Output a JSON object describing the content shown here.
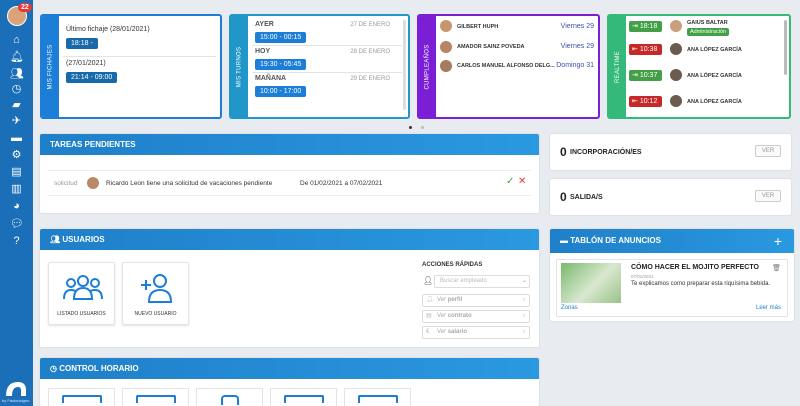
{
  "sidebar": {
    "badge": "22",
    "icons": [
      "home-icon",
      "bell-icon",
      "users-icon",
      "clock-icon",
      "briefcase-icon",
      "plane-icon",
      "folder-icon",
      "gear-icon",
      "clipboard-icon",
      "document-icon",
      "pie-chart-icon",
      "chat-icon",
      "help-icon"
    ],
    "brand": "by Factorialgeo"
  },
  "fichajes": {
    "tab": "MIS FICHAJES",
    "last_label": "Último fichaje (28/01/2021)",
    "last_value": "18:18 -",
    "prev_label": "(27/01/2021)",
    "prev_value": "21:14 - 09:00"
  },
  "turnos": {
    "tab": "MIS TURNOS",
    "rows": [
      {
        "day": "AYER",
        "date": "27 DE ENERO",
        "range": "15:00 - 00:15"
      },
      {
        "day": "HOY",
        "date": "28 DE ENERO",
        "range": "19:30 - 05:45"
      },
      {
        "day": "MAÑANA",
        "date": "29 DE ENERO",
        "range": "10:00 - 17:00"
      }
    ]
  },
  "cumple": {
    "tab": "CUMPLEAÑOS",
    "rows": [
      {
        "name": "GILBERT HUPH",
        "day": "Viernes 29"
      },
      {
        "name": "AMADOR SAINZ POVEDA",
        "day": "Viernes 29"
      },
      {
        "name": "CARLOS MANUEL ALFONSO DELG...",
        "day": "Domingo 31"
      }
    ]
  },
  "realtime": {
    "tab": "REALTIME",
    "rows": [
      {
        "time": "18:18",
        "name": "GAIUS BALTAR",
        "tag": "Administración",
        "color": "#43a047"
      },
      {
        "time": "10:38",
        "name": "ANA LÓPEZ GARCÍA",
        "tag": "",
        "color": "#c62828"
      },
      {
        "time": "10:37",
        "name": "ANA LÓPEZ GARCÍA",
        "tag": "",
        "color": "#43a047"
      },
      {
        "time": "10:12",
        "name": "ANA LÓPEZ GARCÍA",
        "tag": "",
        "color": "#c62828"
      }
    ]
  },
  "tareas": {
    "title": "TAREAS PENDIENTES",
    "type": "solicitud",
    "text": "Ricardo Leon tiene una solicitud de vacaciones pendiente",
    "dates": "De 01/02/2021 a 07/02/2021"
  },
  "incorporacion": {
    "count": "0",
    "label": "INCORPORACIÓN/ES",
    "btn": "VER"
  },
  "salida": {
    "count": "0",
    "label": "SALIDA/S",
    "btn": "VER"
  },
  "usuarios": {
    "title": "USUARIOS",
    "tile1": "LISTADO USUARIOS",
    "tile2": "NUEVO USUARIO",
    "quick_title": "ACCIONES RÁPIDAS",
    "search_placeholder": "Buscar empleado",
    "actions": [
      {
        "prefix": "Ver",
        "label": "perfil"
      },
      {
        "prefix": "Ver",
        "label": "contrato"
      },
      {
        "prefix": "Ver",
        "label": "salario"
      }
    ]
  },
  "anuncios": {
    "title": "TABLÓN DE ANUNCIOS",
    "post_title": "CÓMO HACER EL MOJITO PERFECTO",
    "post_date": "07/01/2021",
    "post_text": "Te explicamos como preparar esta riquísima bebida.",
    "zone": "Zonas",
    "more": "Leer más"
  },
  "control": {
    "title": "CONTROL HORARIO"
  },
  "colors": {
    "primary": "#1b6fb8",
    "header": "#2a99df",
    "fichajes": "#1c7ed6",
    "turnos": "#2196c9",
    "cumple": "#7b1fd6",
    "realtime": "#35b97a"
  }
}
